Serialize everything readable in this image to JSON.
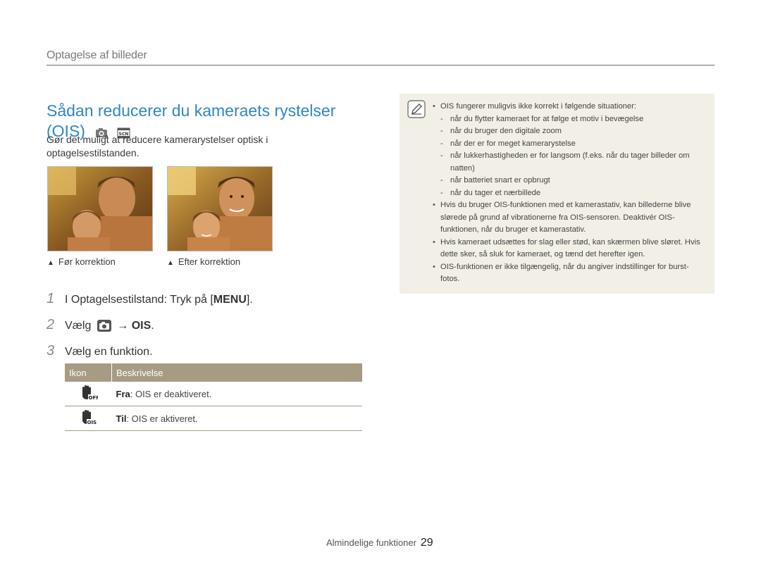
{
  "header": {
    "section": "Optagelse af billeder"
  },
  "title": {
    "text": "Sådan reducerer du kameraets rystelser (OIS)"
  },
  "intro": "Gør det muligt at reducere kamerarystelser optisk i optagelsestilstanden.",
  "photos": [
    {
      "caption": "Før korrektion"
    },
    {
      "caption": "Efter korrektion"
    }
  ],
  "steps": [
    {
      "num": "1",
      "pre": "I Optagelsestilstand: Tryk på [",
      "key": "MENU",
      "post": "]."
    },
    {
      "num": "2",
      "pre": "Vælg",
      "arrow": "→",
      "key": "OIS",
      "post": "."
    },
    {
      "num": "3",
      "pre": "Vælg en funktion."
    }
  ],
  "table": {
    "headers": [
      "Ikon",
      "Beskrivelse"
    ],
    "rows": [
      {
        "icon": "ois-off-icon",
        "name": "Fra",
        "desc": ": OIS er deaktiveret."
      },
      {
        "icon": "ois-on-icon",
        "name": "Til",
        "desc": ": OIS er aktiveret."
      }
    ]
  },
  "note": {
    "bullets": [
      {
        "text": "OIS fungerer muligvis ikke korrekt i følgende situationer:",
        "sub": [
          "når du flytter kameraet for at følge et motiv i bevægelse",
          "når du bruger den digitale zoom",
          "når der er for meget kamerarystelse",
          "når lukkerhastigheden er for langsom (f.eks. når du tager billeder om natten)",
          "når batteriet snart er opbrugt",
          "når du tager et nærbillede"
        ]
      },
      {
        "text": "Hvis du bruger OIS-funktionen med et kamerastativ, kan billederne blive slørede på grund af vibrationerne fra OIS-sensoren. Deaktivér OIS-funktionen, når du bruger et kamerastativ."
      },
      {
        "text": "Hvis kameraet udsættes for slag eller stød, kan skærmen blive sløret. Hvis dette sker, så sluk for kameraet, og tænd det herefter igen."
      },
      {
        "text": "OIS-funktionen er ikke tilgængelig, når du angiver indstillinger for burst-fotos."
      }
    ]
  },
  "footer": {
    "section": "Almindelige funktioner",
    "page": "29"
  },
  "colors": {
    "accent": "#2f86c8",
    "table_header": "#a79c83",
    "note_bg": "#f2efe6"
  }
}
